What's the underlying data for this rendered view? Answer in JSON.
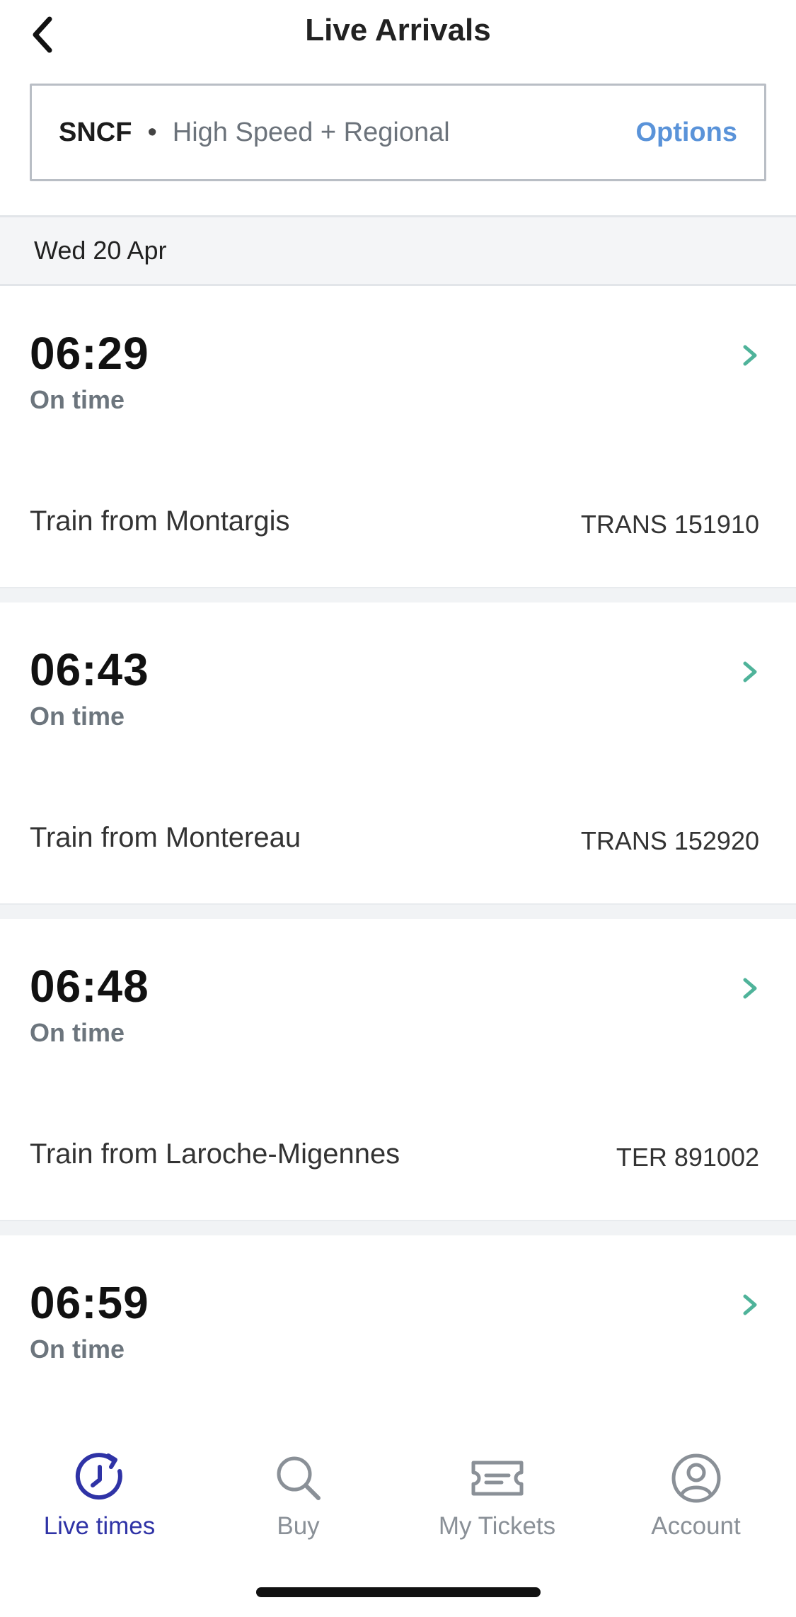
{
  "header": {
    "title": "Live Arrivals"
  },
  "filter": {
    "operator": "SNCF",
    "separator": "•",
    "service": "High Speed + Regional",
    "options_label": "Options"
  },
  "date": "Wed 20 Apr",
  "arrivals": [
    {
      "time": "06:29",
      "status": "On time",
      "origin": "Train from Montargis",
      "train": "TRANS 151910"
    },
    {
      "time": "06:43",
      "status": "On time",
      "origin": "Train from Montereau",
      "train": "TRANS 152920"
    },
    {
      "time": "06:48",
      "status": "On time",
      "origin": "Train from Laroche-Migennes",
      "train": "TER 891002"
    },
    {
      "time": "06:59",
      "status": "On time",
      "origin": "",
      "train": ""
    }
  ],
  "tabs": [
    {
      "label": "Live times",
      "icon": "clock-refresh-icon",
      "active": true
    },
    {
      "label": "Buy",
      "icon": "search-icon",
      "active": false
    },
    {
      "label": "My Tickets",
      "icon": "ticket-icon",
      "active": false
    },
    {
      "label": "Account",
      "icon": "account-icon",
      "active": false
    }
  ],
  "colors": {
    "accent_blue": "#5a93d9",
    "active_tab": "#2f33a6",
    "chevron_green": "#4fb39a",
    "inactive_gray": "#8a9097"
  }
}
